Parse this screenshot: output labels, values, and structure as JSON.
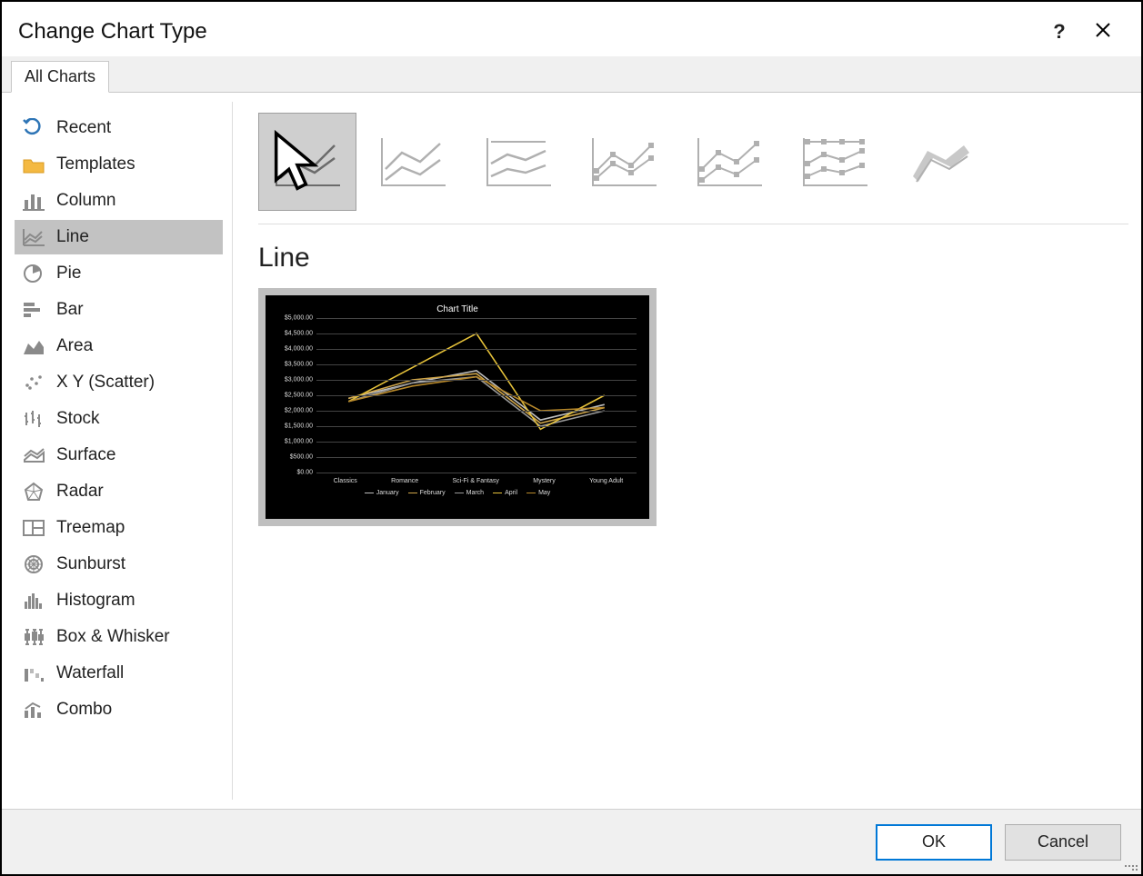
{
  "dialog": {
    "title": "Change Chart Type",
    "help_tooltip": "?",
    "close_tooltip": "✕"
  },
  "tabs": [
    {
      "label": "All Charts",
      "active": true
    }
  ],
  "sidebar": {
    "items": [
      {
        "id": "recent",
        "label": "Recent",
        "icon": "undo-icon"
      },
      {
        "id": "templates",
        "label": "Templates",
        "icon": "folder-icon"
      },
      {
        "id": "column",
        "label": "Column",
        "icon": "column-icon"
      },
      {
        "id": "line",
        "label": "Line",
        "icon": "line-icon",
        "selected": true
      },
      {
        "id": "pie",
        "label": "Pie",
        "icon": "pie-icon"
      },
      {
        "id": "bar",
        "label": "Bar",
        "icon": "bar-icon"
      },
      {
        "id": "area",
        "label": "Area",
        "icon": "area-icon"
      },
      {
        "id": "scatter",
        "label": "X Y (Scatter)",
        "icon": "scatter-icon"
      },
      {
        "id": "stock",
        "label": "Stock",
        "icon": "stock-icon"
      },
      {
        "id": "surface",
        "label": "Surface",
        "icon": "surface-icon"
      },
      {
        "id": "radar",
        "label": "Radar",
        "icon": "radar-icon"
      },
      {
        "id": "treemap",
        "label": "Treemap",
        "icon": "treemap-icon"
      },
      {
        "id": "sunburst",
        "label": "Sunburst",
        "icon": "sunburst-icon"
      },
      {
        "id": "histogram",
        "label": "Histogram",
        "icon": "histogram-icon"
      },
      {
        "id": "boxwhisker",
        "label": "Box & Whisker",
        "icon": "boxwhisker-icon"
      },
      {
        "id": "waterfall",
        "label": "Waterfall",
        "icon": "waterfall-icon"
      },
      {
        "id": "combo",
        "label": "Combo",
        "icon": "combo-icon"
      }
    ]
  },
  "main": {
    "heading": "Line",
    "subtypes": [
      {
        "id": "line",
        "label": "Line",
        "selected": true
      },
      {
        "id": "stacked-line",
        "label": "Stacked Line"
      },
      {
        "id": "percent-stacked",
        "label": "100% Stacked Line"
      },
      {
        "id": "line-markers",
        "label": "Line with Markers"
      },
      {
        "id": "stacked-markers",
        "label": "Stacked Line with Markers"
      },
      {
        "id": "percent-markers",
        "label": "100% Stacked Line with Markers"
      },
      {
        "id": "3d-line",
        "label": "3-D Line"
      }
    ]
  },
  "chart_data": {
    "type": "line",
    "title": "Chart Title",
    "xlabel": "",
    "ylabel": "",
    "ylim": [
      0,
      5000
    ],
    "ytick_interval": 500,
    "yticks": [
      "$0.00",
      "$500.00",
      "$1,000.00",
      "$1,500.00",
      "$2,000.00",
      "$2,500.00",
      "$3,000.00",
      "$3,500.00",
      "$4,000.00",
      "$4,500.00",
      "$5,000.00"
    ],
    "categories": [
      "Classics",
      "Romance",
      "Sci-Fi & Fantasy",
      "Mystery",
      "Young Adult"
    ],
    "series": [
      {
        "name": "January",
        "color": "#bdbdbd",
        "values": [
          2400,
          2900,
          3300,
          1700,
          2200
        ]
      },
      {
        "name": "February",
        "color": "#d0a64a",
        "values": [
          2400,
          3000,
          3200,
          1600,
          2100
        ]
      },
      {
        "name": "March",
        "color": "#999999",
        "values": [
          2300,
          2900,
          3100,
          1500,
          2000
        ]
      },
      {
        "name": "April",
        "color": "#e6c23a",
        "values": [
          2300,
          3400,
          4500,
          1400,
          2500
        ]
      },
      {
        "name": "May",
        "color": "#b8892b",
        "values": [
          2300,
          2800,
          3100,
          2000,
          2100
        ]
      }
    ],
    "legend_position": "bottom"
  },
  "footer": {
    "ok_label": "OK",
    "cancel_label": "Cancel"
  }
}
